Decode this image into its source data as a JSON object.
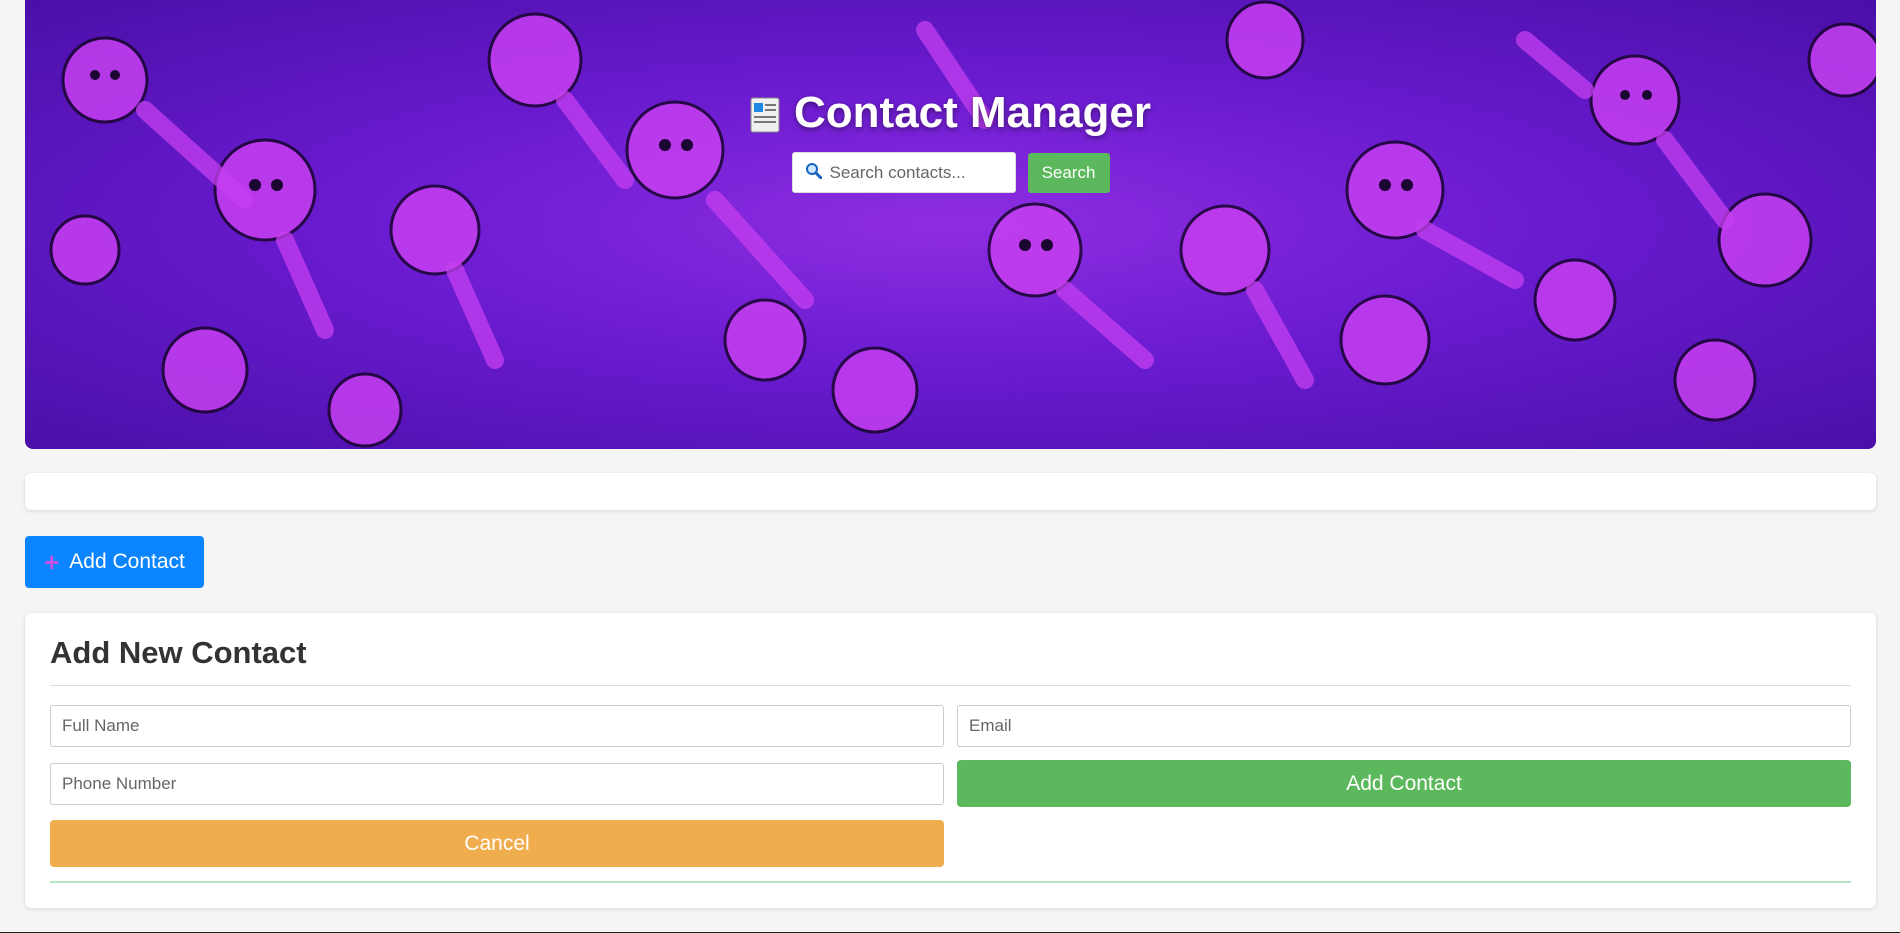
{
  "header": {
    "title": "Contact Manager",
    "icon": "clipboard-icon",
    "search_placeholder": "Search contacts...",
    "search_icon": "magnifier-icon",
    "search_button": "Search"
  },
  "toolbar": {
    "add_toggle_label": "Add Contact",
    "add_toggle_icon": "plus-icon"
  },
  "form": {
    "title": "Add New Contact",
    "name_placeholder": "Full Name",
    "email_placeholder": "Email",
    "phone_placeholder": "Phone Number",
    "submit_label": "Add Contact",
    "cancel_label": "Cancel"
  },
  "colors": {
    "primary": "#0a84ff",
    "success": "#5cb85c",
    "warning": "#f0ad4e",
    "banner": "#7b1fd6"
  }
}
